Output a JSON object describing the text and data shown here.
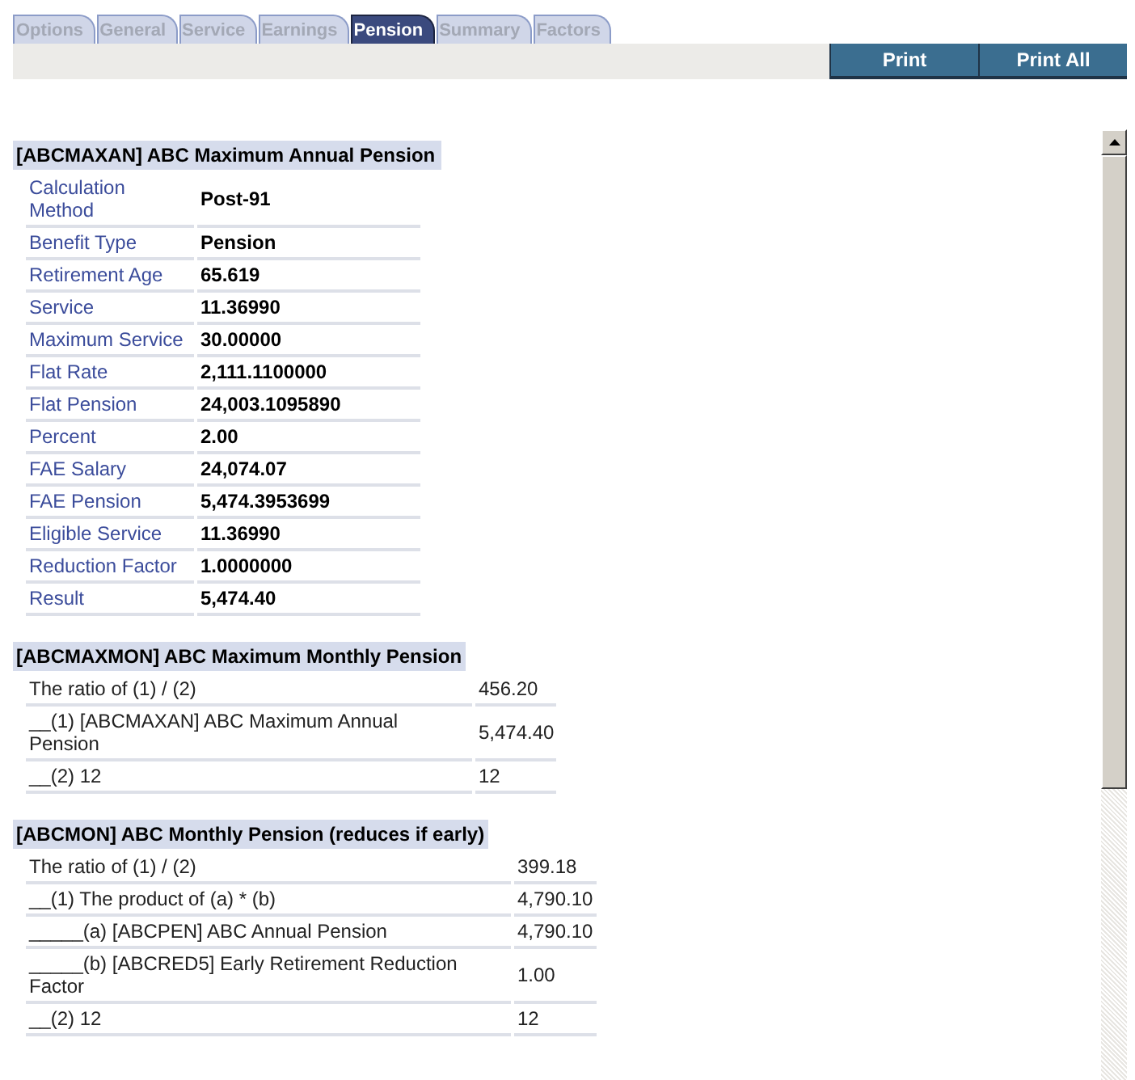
{
  "tabs": [
    {
      "label": "Options",
      "selected": false
    },
    {
      "label": "General",
      "selected": false
    },
    {
      "label": "Service",
      "selected": false
    },
    {
      "label": "Earnings",
      "selected": false
    },
    {
      "label": "Pension",
      "selected": true
    },
    {
      "label": "Summary",
      "selected": false
    },
    {
      "label": "Factors",
      "selected": false
    }
  ],
  "buttons": [
    "Print",
    "Print All"
  ],
  "sections": [
    {
      "kind": "fields",
      "title": "[ABCMAXAN] ABC Maximum Annual Pension",
      "rows": [
        {
          "label": "Calculation Method",
          "value": "Post-91"
        },
        {
          "label": "Benefit Type",
          "value": "Pension"
        },
        {
          "label": "Retirement Age",
          "value": "65.619"
        },
        {
          "label": "Service",
          "value": "11.36990"
        },
        {
          "label": "Maximum Service",
          "value": "30.00000"
        },
        {
          "label": "Flat Rate",
          "value": "2,111.1100000"
        },
        {
          "label": "Flat Pension",
          "value": "24,003.1095890"
        },
        {
          "label": "Percent",
          "value": "2.00"
        },
        {
          "label": "FAE Salary",
          "value": "24,074.07"
        },
        {
          "label": "FAE Pension",
          "value": "5,474.3953699"
        },
        {
          "label": "Eligible Service",
          "value": "11.36990"
        },
        {
          "label": "Reduction Factor",
          "value": "1.0000000"
        },
        {
          "label": "Result",
          "value": "5,474.40"
        }
      ]
    },
    {
      "kind": "calc",
      "title": "[ABCMAXMON] ABC Maximum Monthly Pension",
      "rows": [
        {
          "label": "The ratio of (1) / (2)",
          "value": "456.20"
        },
        {
          "label": "__(1) [ABCMAXAN] ABC Maximum Annual Pension",
          "value": "5,474.40"
        },
        {
          "label": "__(2) 12",
          "value": "12"
        }
      ]
    },
    {
      "kind": "calc",
      "title": "[ABCMON] ABC Monthly Pension (reduces if early)",
      "rows": [
        {
          "label": "The ratio of (1) / (2)",
          "value": "399.18"
        },
        {
          "label": "__(1) The product of (a) * (b)",
          "value": "4,790.10"
        },
        {
          "label": "_____(a) [ABCPEN] ABC Annual Pension",
          "value": "4,790.10"
        },
        {
          "label": "_____(b) [ABCRED5] Early Retirement Reduction Factor",
          "value": "1.00"
        },
        {
          "label": "__(2) 12",
          "value": "12"
        }
      ]
    }
  ]
}
